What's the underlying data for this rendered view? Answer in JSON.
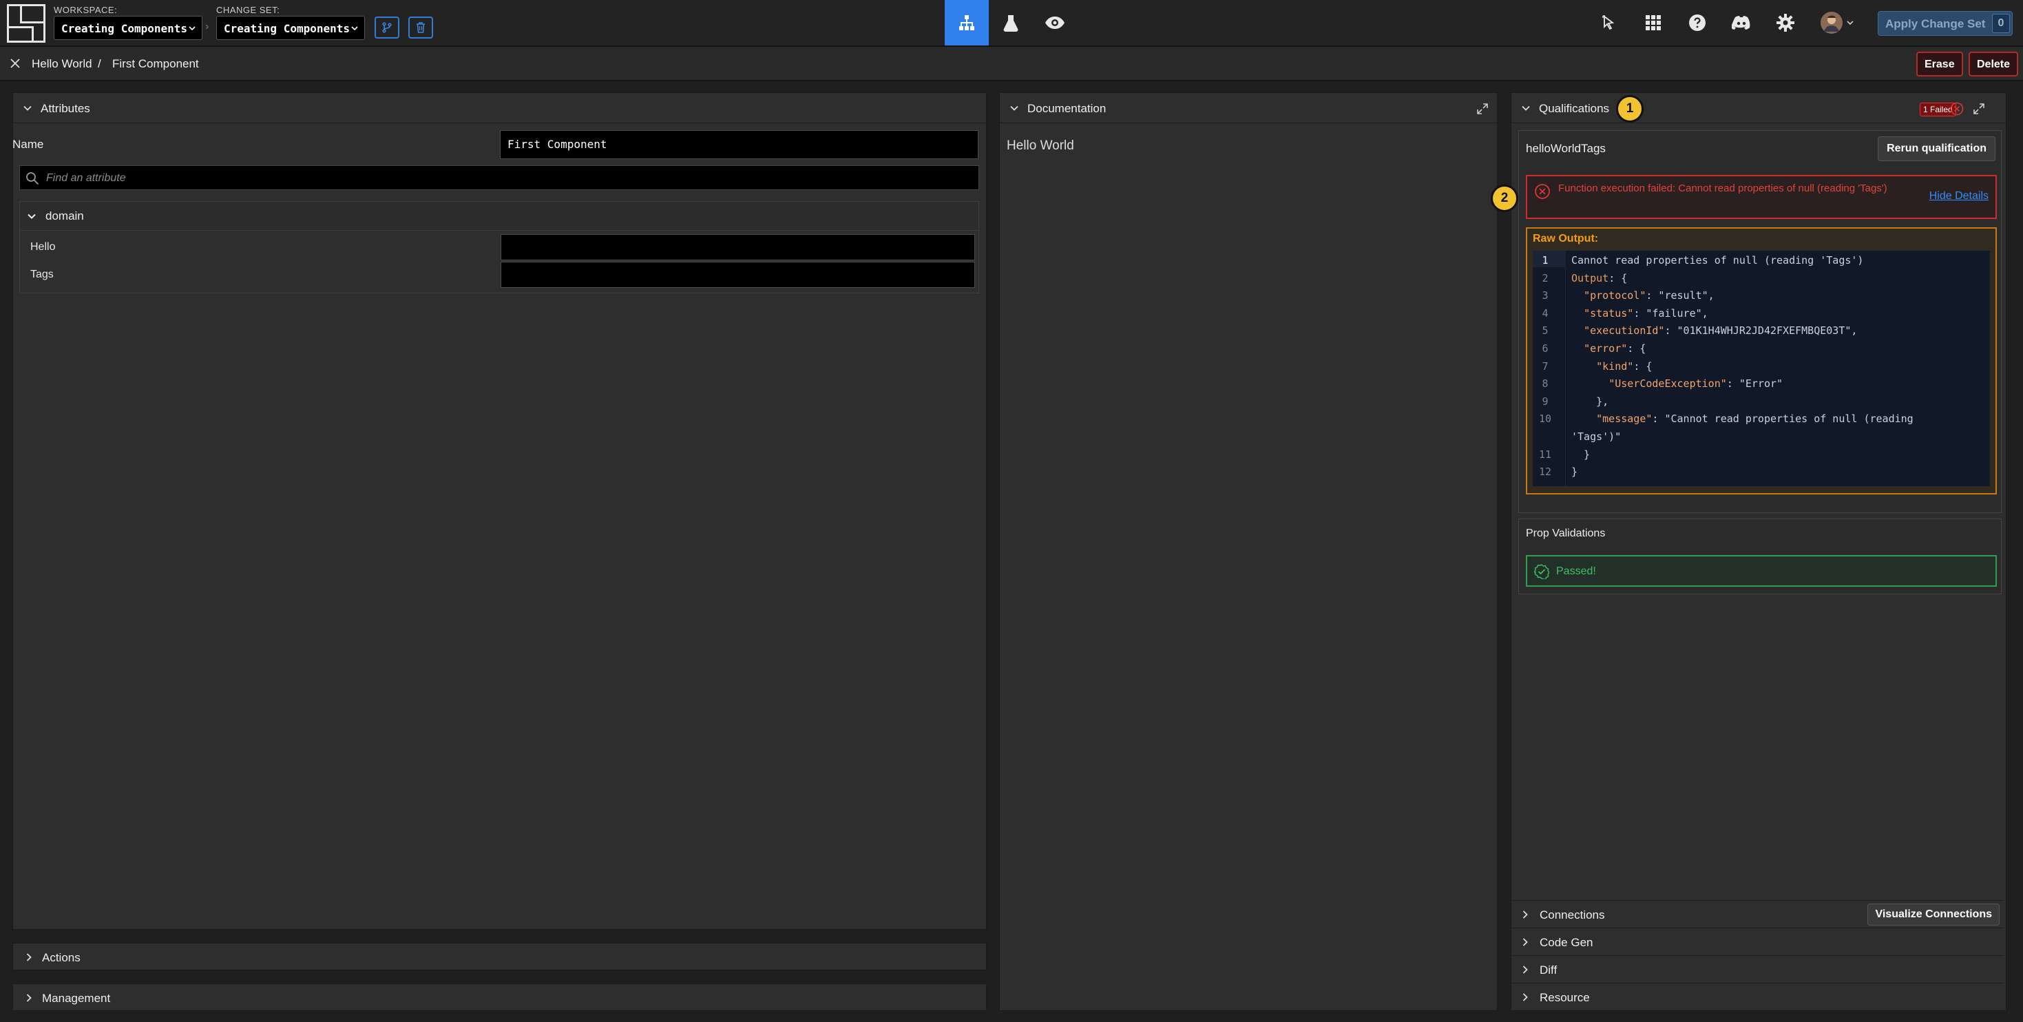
{
  "topbar": {
    "workspace_label": "WORKSPACE:",
    "workspace_value": "Creating Components",
    "changeset_label": "CHANGE SET:",
    "changeset_value": "Creating Components",
    "apply_label": "Apply Change Set",
    "apply_count": "0",
    "accent_color": "#2f80ed"
  },
  "breadcrumb": {
    "parent": "Hello World",
    "separator": "/",
    "current": "First Component",
    "erase_label": "Erase",
    "delete_label": "Delete"
  },
  "attributes": {
    "title": "Attributes",
    "name_label": "Name",
    "name_value": "First Component",
    "search_placeholder": "Find an attribute",
    "domain_label": "domain",
    "props": [
      {
        "label": "Hello",
        "value": ""
      },
      {
        "label": "Tags",
        "value": ""
      }
    ]
  },
  "bottom_left": {
    "actions": "Actions",
    "management": "Management"
  },
  "documentation": {
    "title": "Documentation",
    "text": "Hello World"
  },
  "qualifications": {
    "title": "Qualifications",
    "badge_1": "1",
    "badge_2": "2",
    "failed_badge": "1 Failed",
    "name": "helloWorldTags",
    "rerun_label": "Rerun qualification",
    "error_message": "Function execution failed: Cannot read properties of null (reading 'Tags')",
    "hide_details": "Hide Details",
    "raw_output_label": "Raw Output:",
    "code_lines": [
      "Cannot read properties of null (reading 'Tags')",
      "Output: {",
      "  \"protocol\": \"result\",",
      "  \"status\": \"failure\",",
      "  \"executionId\": \"01K1H4WHJR2JD42FXEFMBQE03T\",",
      "  \"error\": {",
      "    \"kind\": {",
      "      \"UserCodeException\": \"Error\"",
      "    },",
      "    \"message\": \"Cannot read properties of null (reading",
      "'Tags')\"",
      "  }",
      "}"
    ],
    "line_numbers": [
      "1",
      "2",
      "3",
      "4",
      "5",
      "6",
      "7",
      "8",
      "9",
      "10",
      "",
      "11",
      "12"
    ],
    "prop_validations_title": "Prop Validations",
    "passed_label": "Passed!",
    "error_color": "#d02a2a",
    "success_color": "#2e9e4f"
  },
  "right_sections": {
    "connections": "Connections",
    "visualize": "Visualize Connections",
    "codegen": "Code Gen",
    "diff": "Diff",
    "resource": "Resource"
  }
}
